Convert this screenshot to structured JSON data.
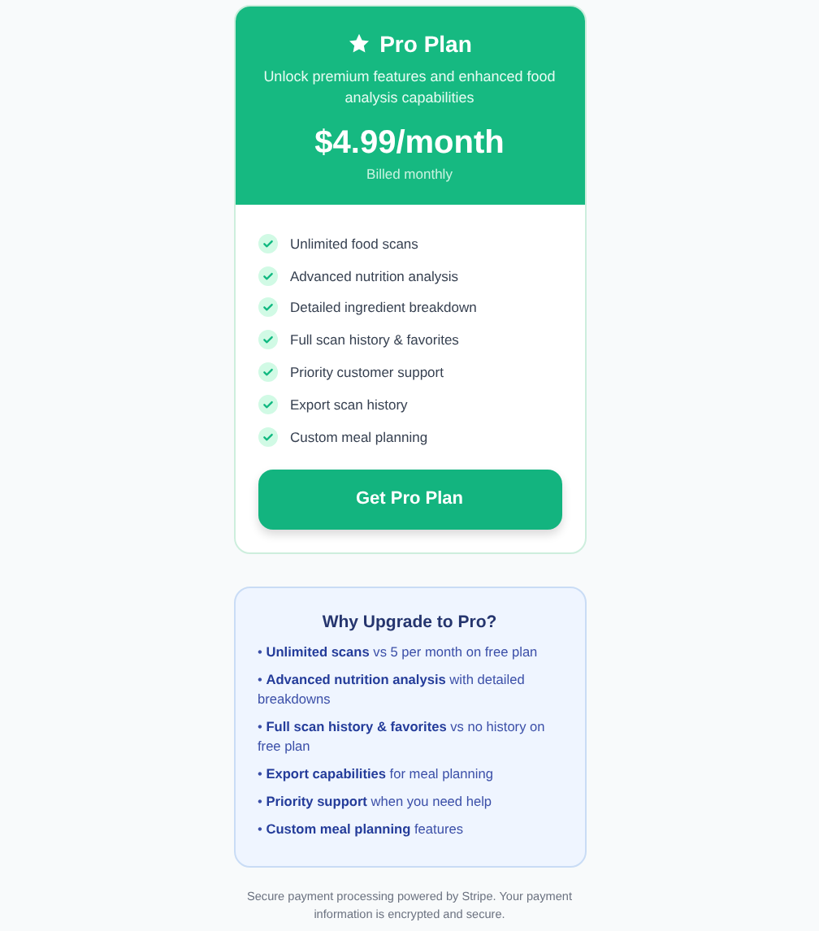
{
  "plan": {
    "title": "Pro Plan",
    "subtitle": "Unlock premium features and enhanced food analysis capabilities",
    "price": "$4.99/month",
    "billing": "Billed monthly",
    "features": [
      "Unlimited food scans",
      "Advanced nutrition analysis",
      "Detailed ingredient breakdown",
      "Full scan history & favorites",
      "Priority customer support",
      "Export scan history",
      "Custom meal planning"
    ],
    "button": "Get Pro Plan"
  },
  "why": {
    "title": "Why Upgrade to Pro?",
    "points": [
      "• **Unlimited scans** vs 5 per month on free plan",
      "• **Advanced nutrition analysis** with detailed breakdowns",
      "• **Full scan history & favorites** vs no history on free plan",
      "• **Export capabilities** for meal planning",
      "• **Priority support** when you need help",
      "• **Custom meal planning** features"
    ]
  },
  "footer": "Secure payment processing powered by Stripe. Your payment information is encrypted and secure."
}
